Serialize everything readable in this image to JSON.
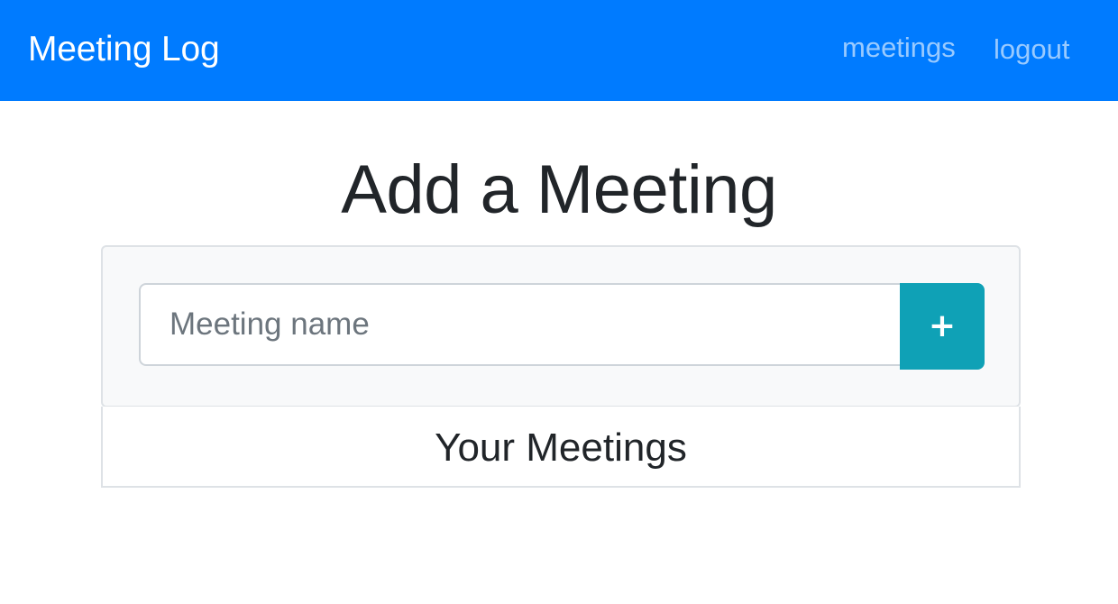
{
  "navbar": {
    "brand": "Meeting Log",
    "links": [
      {
        "label": "meetings"
      },
      {
        "label": "logout"
      }
    ],
    "background_color": "#007bff"
  },
  "page": {
    "title": "Add a Meeting"
  },
  "add_form": {
    "input_placeholder": "Meeting name",
    "input_value": "",
    "add_button_label": "+",
    "add_button_color": "#17a2b8"
  },
  "meetings_list": {
    "heading": "Your Meetings",
    "items": []
  }
}
